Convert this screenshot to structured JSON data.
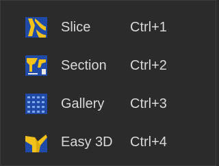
{
  "menu": {
    "items": [
      {
        "label": "Slice",
        "shortcut": "Ctrl+1",
        "icon": "slice-icon"
      },
      {
        "label": "Section",
        "shortcut": "Ctrl+2",
        "icon": "section-icon"
      },
      {
        "label": "Gallery",
        "shortcut": "Ctrl+3",
        "icon": "gallery-icon"
      },
      {
        "label": "Easy 3D",
        "shortcut": "Ctrl+4",
        "icon": "easy-3d-icon"
      }
    ]
  },
  "colors": {
    "background": "#2b2b2b",
    "text": "#d9d9d9",
    "icon_blue": "#1f4aa8",
    "icon_yellow": "#f3c21a"
  }
}
